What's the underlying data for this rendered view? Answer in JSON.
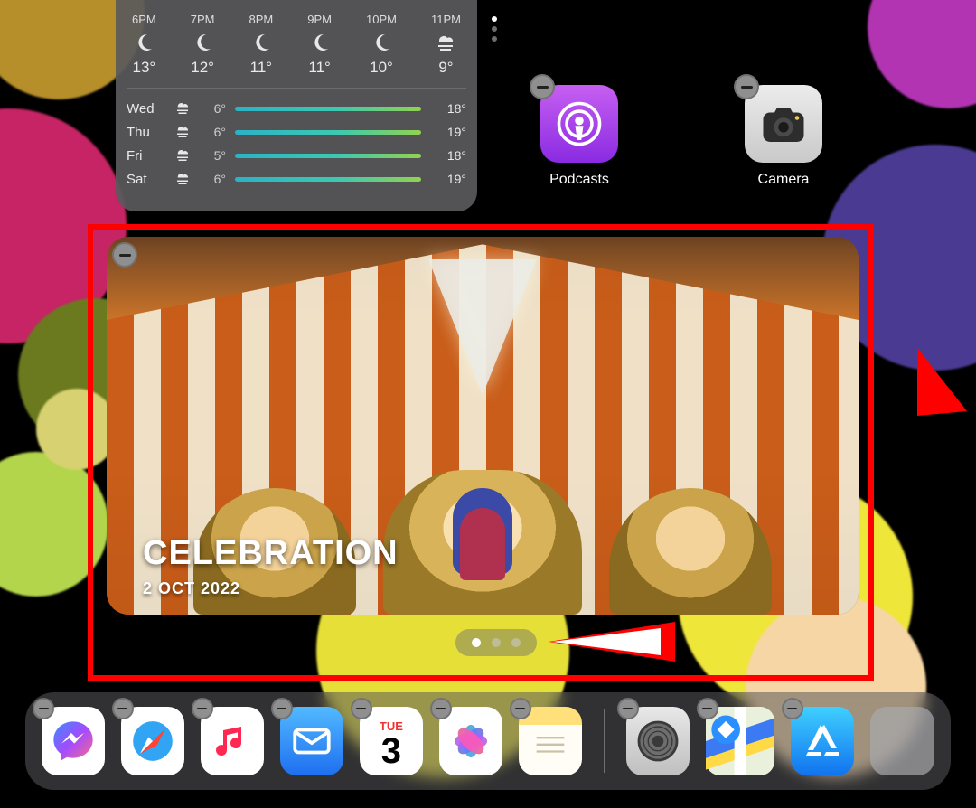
{
  "weather": {
    "hourly": [
      {
        "time": "6PM",
        "temp": "13°"
      },
      {
        "time": "7PM",
        "temp": "12°"
      },
      {
        "time": "8PM",
        "temp": "11°"
      },
      {
        "time": "9PM",
        "temp": "11°"
      },
      {
        "time": "10PM",
        "temp": "10°"
      },
      {
        "time": "11PM",
        "temp": "9°"
      }
    ],
    "daily": [
      {
        "day": "Wed",
        "lo": "6°",
        "hi": "18°"
      },
      {
        "day": "Thu",
        "lo": "6°",
        "hi": "19°"
      },
      {
        "day": "Fri",
        "lo": "5°",
        "hi": "18°"
      },
      {
        "day": "Sat",
        "lo": "6°",
        "hi": "19°"
      }
    ]
  },
  "home_apps": {
    "podcasts": "Podcasts",
    "camera": "Camera"
  },
  "photos_widget": {
    "title": "CELEBRATION",
    "date": "2 OCT 2022"
  },
  "calendar": {
    "weekday": "TUE",
    "day": "3"
  },
  "dock": {
    "messenger": "Messenger",
    "safari": "Safari",
    "music": "Music",
    "mail": "Mail",
    "calendar": "Calendar",
    "photos": "Photos",
    "notes": "Notes",
    "settings": "Settings",
    "maps": "Maps",
    "appstore": "App Store",
    "library": "App Library"
  }
}
